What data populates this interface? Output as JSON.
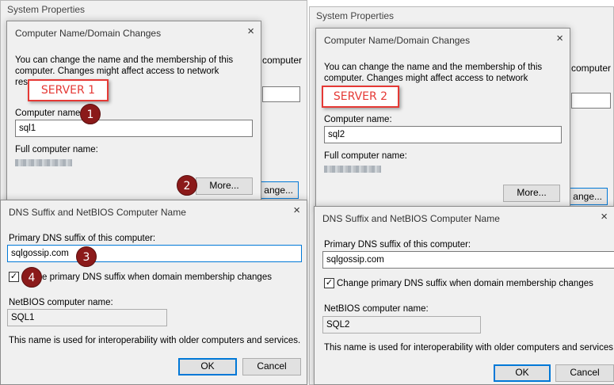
{
  "left": {
    "system_properties": {
      "title": "System Properties",
      "peek_label": "computer",
      "peek_button": "ange..."
    },
    "computer_dialog": {
      "title": "Computer Name/Domain Changes",
      "intro": "You can change the name and the membership of this computer. Changes might affect access to network resources.",
      "server_label": "SERVER 1",
      "computer_name_label": "Computer name:",
      "computer_name_value": "sql1",
      "full_name_label": "Full computer name:",
      "more_button": "More..."
    },
    "dns_dialog": {
      "title": "DNS Suffix and NetBIOS Computer Name",
      "primary_label": "Primary DNS suffix of this computer:",
      "primary_value": "sqlgossip.com",
      "checkbox_label": "Change primary DNS suffix when domain membership changes",
      "checkbox_visible": "e primary DNS suffix when domain membership changes",
      "netbios_label": "NetBIOS computer name:",
      "netbios_value": "SQL1",
      "info": "This name is used for interoperability with older computers and services.",
      "ok": "OK",
      "cancel": "Cancel"
    },
    "badges": [
      "1",
      "2",
      "3",
      "4"
    ]
  },
  "right": {
    "system_properties": {
      "title": "System Properties",
      "peek_label": "computer",
      "peek_button": "ange..."
    },
    "computer_dialog": {
      "title": "Computer Name/Domain Changes",
      "intro": "You can change the name and the membership of this computer. Changes might affect access to network resources.",
      "server_label": "SERVER 2",
      "computer_name_label": "Computer name:",
      "computer_name_value": "sql2",
      "full_name_label": "Full computer name:",
      "more_button": "More..."
    },
    "dns_dialog": {
      "title": "DNS Suffix and NetBIOS Computer Name",
      "primary_label": "Primary DNS suffix of this computer:",
      "primary_value": "sqlgossip.com",
      "checkbox_label": "Change primary DNS suffix when domain membership changes",
      "netbios_label": "NetBIOS computer name:",
      "netbios_value": "SQL2",
      "info": "This name is used for interoperability with older computers and services.",
      "ok": "OK",
      "cancel": "Cancel"
    }
  },
  "icons": {
    "close": "×",
    "check": "✓"
  },
  "colors": {
    "accent": "#0078d7",
    "annotation_red": "#e53935",
    "badge": "#8b1a1a"
  }
}
